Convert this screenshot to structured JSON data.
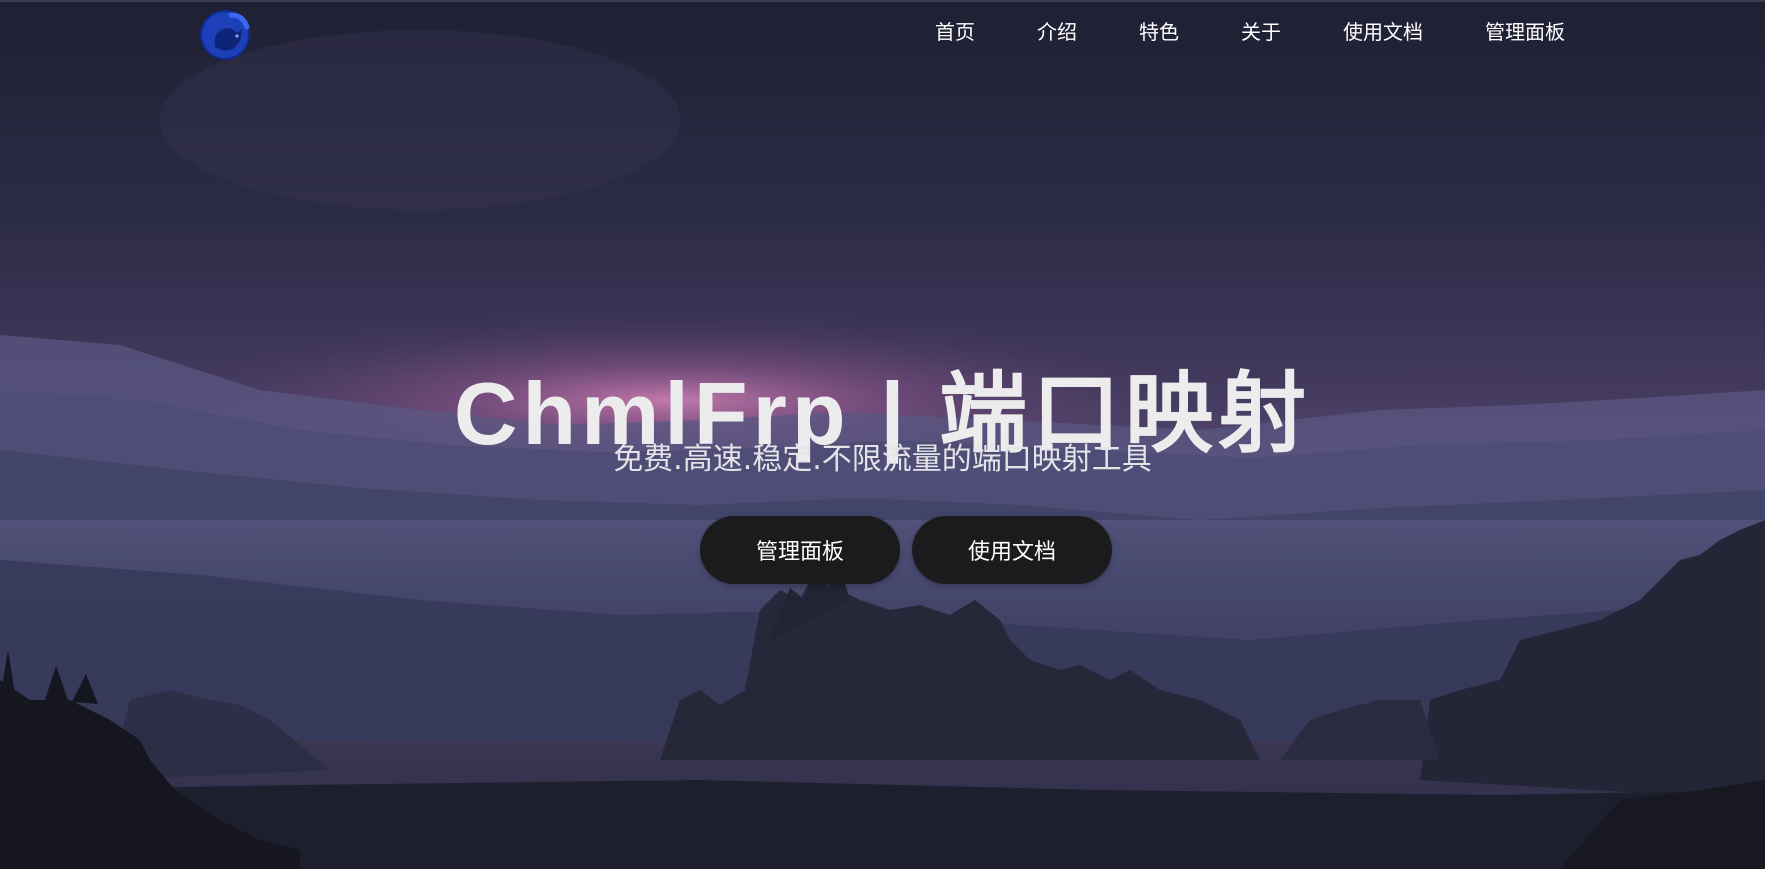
{
  "site": {
    "logo_icon": "blue-cat-logo-icon",
    "brand_color": "#1f4fd6"
  },
  "nav": {
    "items": [
      {
        "label": "首页"
      },
      {
        "label": "介绍"
      },
      {
        "label": "特色"
      },
      {
        "label": "关于"
      },
      {
        "label": "使用文档"
      },
      {
        "label": "管理面板"
      }
    ]
  },
  "hero": {
    "title": "ChmlFrp | 端口映射",
    "subtitle": "免费.高速.稳定.不限流量的端口映射工具",
    "background": "dusk-mountain-landscape",
    "buttons": [
      {
        "label": "管理面板"
      },
      {
        "label": "使用文档"
      }
    ]
  }
}
